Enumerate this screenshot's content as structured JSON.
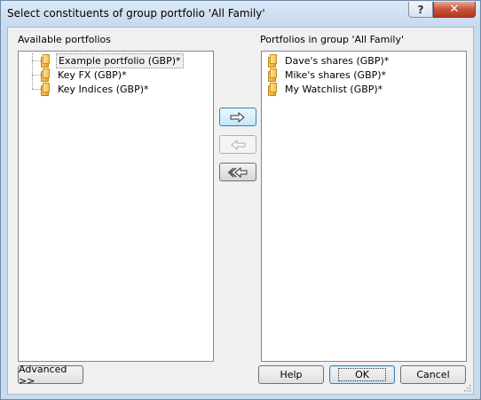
{
  "window": {
    "title": "Select constituents of group portfolio 'All Family'",
    "help_glyph": "?",
    "close_glyph": "✕"
  },
  "available": {
    "label": "Available portfolios",
    "items": [
      {
        "label": "Example portfolio (GBP)*",
        "selected": true
      },
      {
        "label": "Key FX (GBP)*",
        "selected": false
      },
      {
        "label": "Key Indices (GBP)*",
        "selected": false
      }
    ]
  },
  "group": {
    "label": "Portfolios in group 'All Family'",
    "items": [
      {
        "label": "Dave's shares  (GBP)*"
      },
      {
        "label": "Mike's shares  (GBP)*"
      },
      {
        "label": "My Watchlist  (GBP)*"
      }
    ]
  },
  "move_buttons": {
    "add_icon": "arrow-right-icon",
    "remove_icon": "arrow-left-icon",
    "remove_all_icon": "double-arrow-left-icon",
    "remove_enabled": false
  },
  "buttons": {
    "advanced": "Advanced >>",
    "help": "Help",
    "ok": "OK",
    "cancel": "Cancel"
  },
  "colors": {
    "focus_border": "#3c7fb1",
    "close_red": "#c7543a"
  }
}
